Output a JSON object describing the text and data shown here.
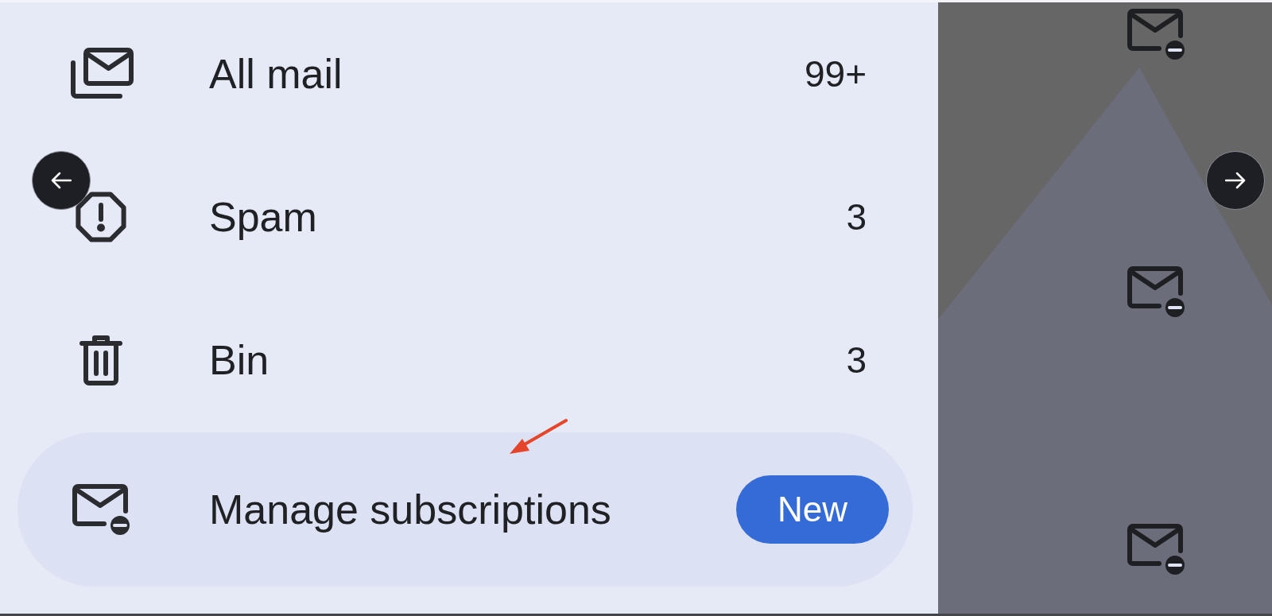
{
  "nav_items": [
    {
      "kind": "all_mail",
      "label": "All mail",
      "count": "99+",
      "selected": false
    },
    {
      "kind": "spam",
      "label": "Spam",
      "count": "3",
      "selected": false
    },
    {
      "kind": "bin",
      "label": "Bin",
      "count": "3",
      "selected": false
    },
    {
      "kind": "subscriptions",
      "label": "Manage subscriptions",
      "badge": "New",
      "selected": true
    }
  ]
}
